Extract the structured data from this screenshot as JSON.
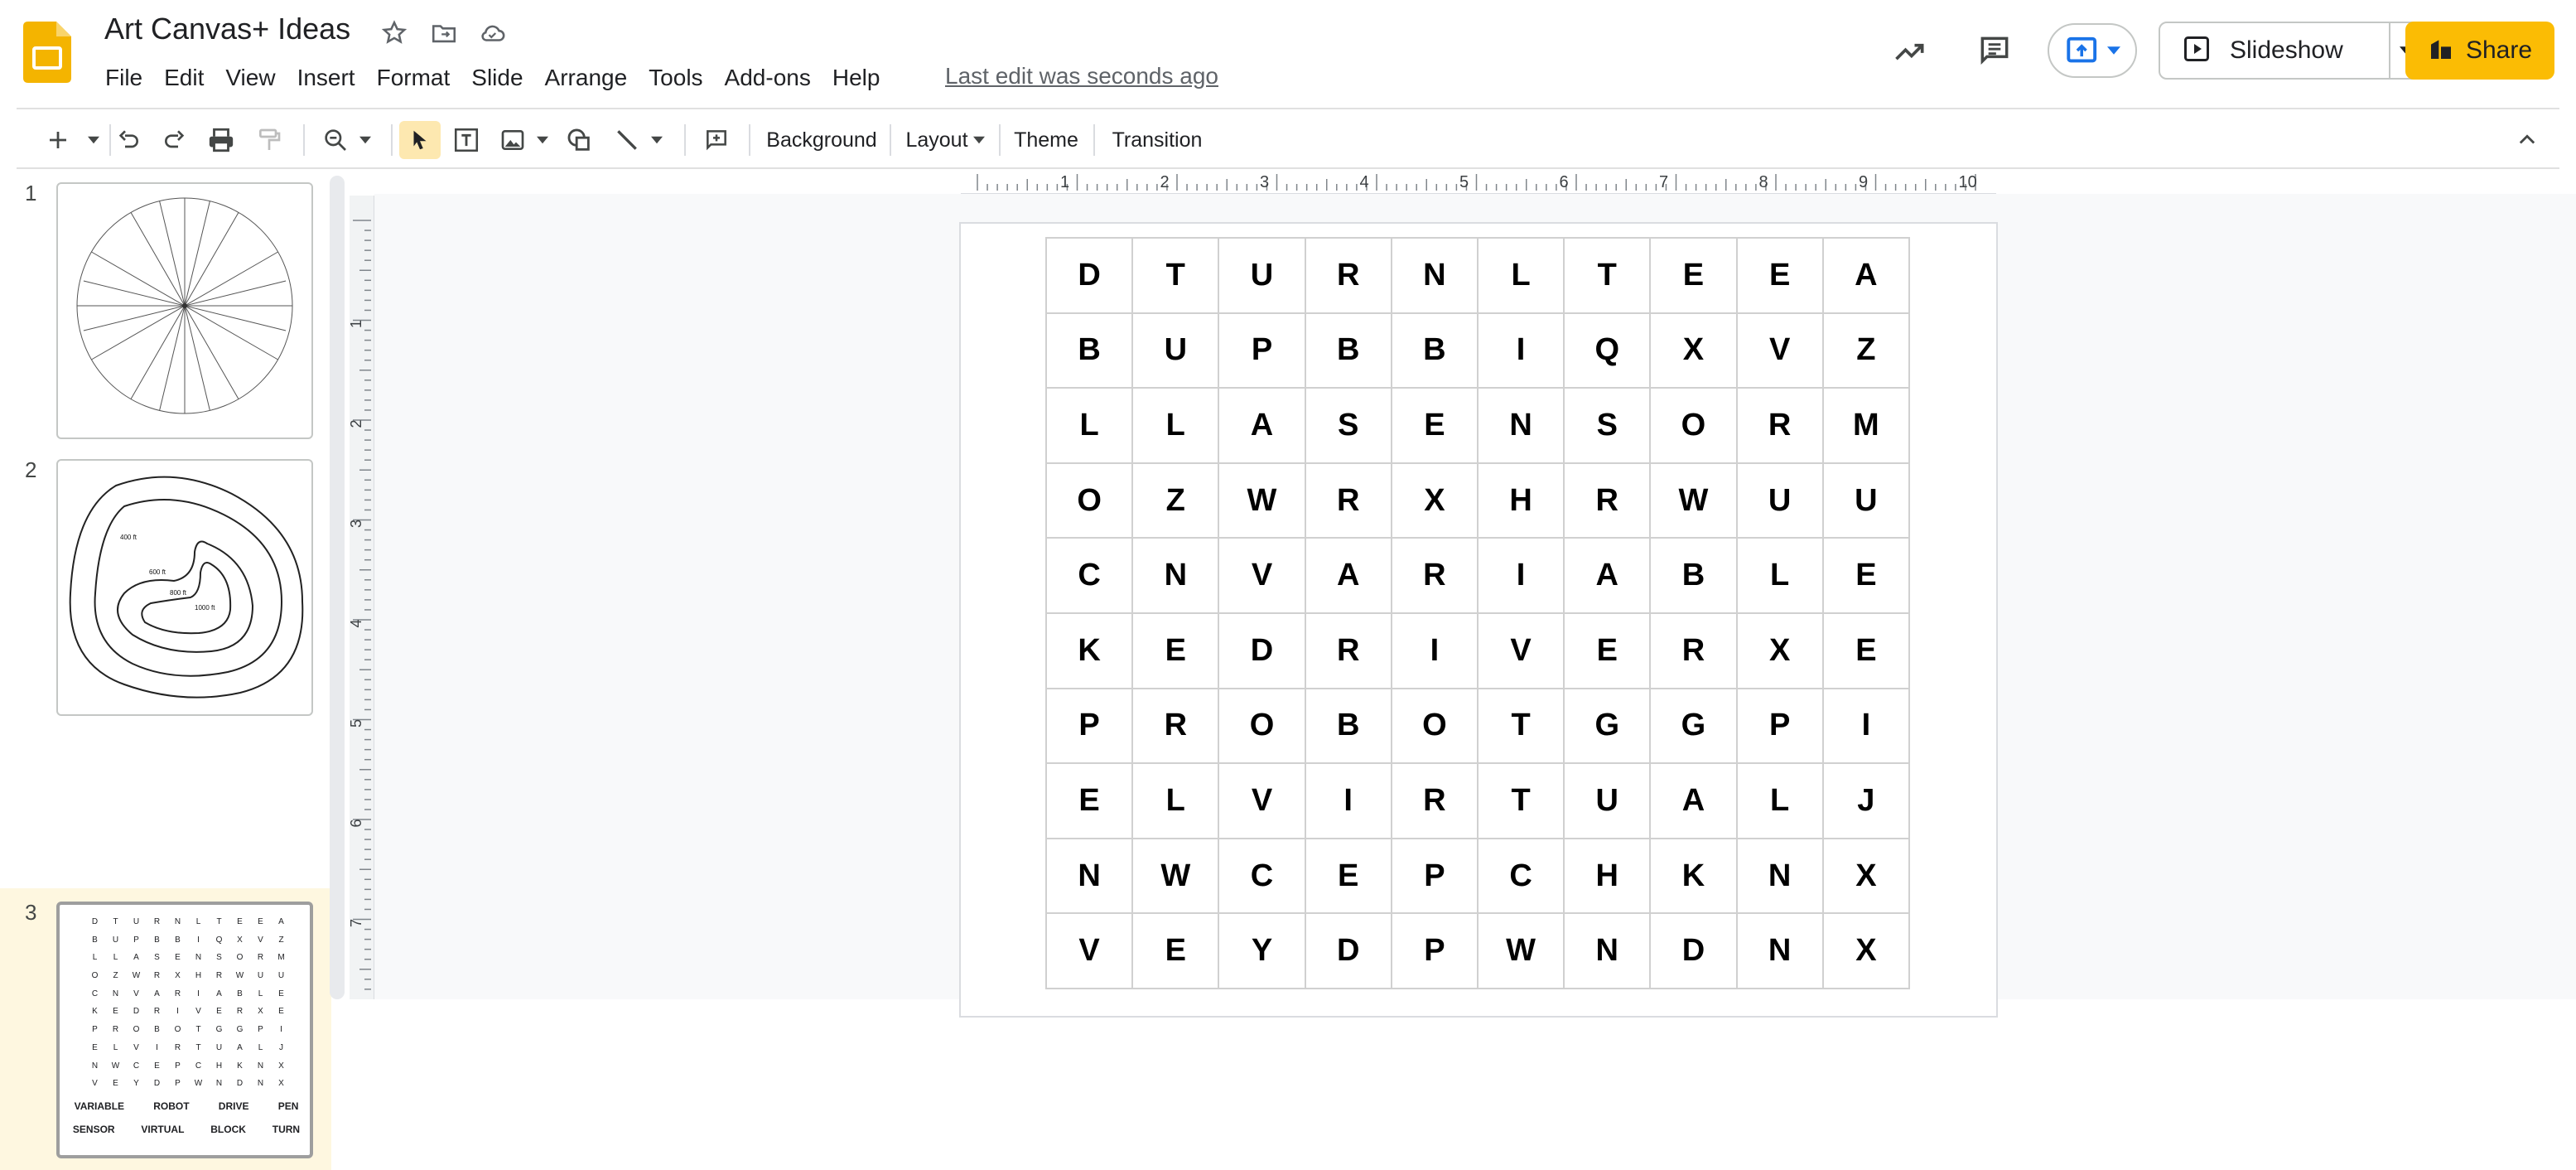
{
  "app": {
    "title": "Art Canvas+ Ideas",
    "last_edit": "Last edit was seconds ago",
    "menu": [
      "File",
      "Edit",
      "View",
      "Insert",
      "Format",
      "Slide",
      "Arrange",
      "Tools",
      "Add-ons",
      "Help"
    ]
  },
  "header": {
    "slideshow_label": "Slideshow",
    "share_label": "Share",
    "brand_color": "#F4B400",
    "share_color": "#FBBC04"
  },
  "toolbar": {
    "background_label": "Background",
    "layout_label": "Layout",
    "theme_label": "Theme",
    "transition_label": "Transition"
  },
  "icons": [
    "new-slide-icon",
    "undo-icon",
    "redo-icon",
    "print-icon",
    "paint-format-icon",
    "zoom-icon",
    "select-icon",
    "text-box-icon",
    "image-icon",
    "shape-icon",
    "line-icon",
    "comment-add-icon",
    "collapse-icon",
    "activity-icon",
    "comments-icon",
    "present-to-meeting-icon",
    "slideshow-icon",
    "share-icon",
    "star-icon",
    "move-icon",
    "cloud-saved-icon"
  ],
  "filmstrip": {
    "slides": [
      {
        "number": "1"
      },
      {
        "number": "2",
        "contour_labels": [
          "400 ft",
          "600 ft",
          "800 ft",
          "1000 ft"
        ]
      },
      {
        "number": "3",
        "words_row1": [
          "VARIABLE",
          "ROBOT",
          "DRIVE",
          "PEN"
        ],
        "words_row2": [
          "SENSOR",
          "VIRTUAL",
          "BLOCK",
          "TURN"
        ]
      }
    ]
  },
  "rulers": {
    "horizontal": [
      "1",
      "2",
      "3",
      "4",
      "5",
      "6",
      "7",
      "8",
      "9",
      "10"
    ],
    "vertical": [
      "1",
      "2",
      "3",
      "4",
      "5",
      "6",
      "7"
    ]
  },
  "word_search": {
    "rows": [
      [
        "D",
        "T",
        "U",
        "R",
        "N",
        "L",
        "T",
        "E",
        "E",
        "A"
      ],
      [
        "B",
        "U",
        "P",
        "B",
        "B",
        "I",
        "Q",
        "X",
        "V",
        "Z"
      ],
      [
        "L",
        "L",
        "A",
        "S",
        "E",
        "N",
        "S",
        "O",
        "R",
        "M"
      ],
      [
        "O",
        "Z",
        "W",
        "R",
        "X",
        "H",
        "R",
        "W",
        "U",
        "U"
      ],
      [
        "C",
        "N",
        "V",
        "A",
        "R",
        "I",
        "A",
        "B",
        "L",
        "E"
      ],
      [
        "K",
        "E",
        "D",
        "R",
        "I",
        "V",
        "E",
        "R",
        "X",
        "E"
      ],
      [
        "P",
        "R",
        "O",
        "B",
        "O",
        "T",
        "G",
        "G",
        "P",
        "I"
      ],
      [
        "E",
        "L",
        "V",
        "I",
        "R",
        "T",
        "U",
        "A",
        "L",
        "J"
      ],
      [
        "N",
        "W",
        "C",
        "E",
        "P",
        "C",
        "H",
        "K",
        "N",
        "X"
      ],
      [
        "V",
        "E",
        "Y",
        "D",
        "P",
        "W",
        "N",
        "D",
        "N",
        "X"
      ]
    ]
  }
}
